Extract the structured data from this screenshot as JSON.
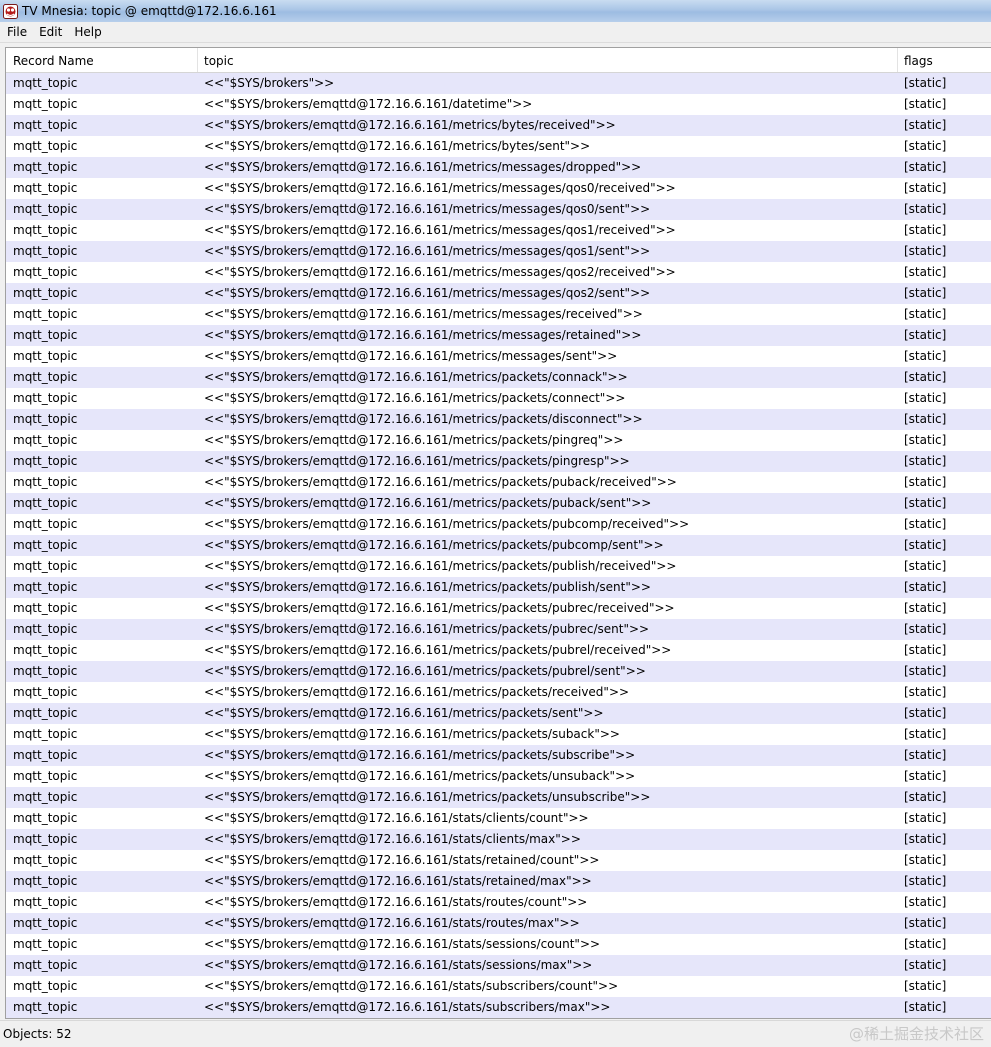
{
  "window": {
    "title": "TV Mnesia: topic @ emqttd@172.16.6.161",
    "icon": "tv-mnesia-app-icon"
  },
  "menu": [
    "File",
    "Edit",
    "Help"
  ],
  "table": {
    "columns": [
      "Record Name",
      "topic",
      "flags"
    ],
    "rows": [
      [
        "mqtt_topic",
        "<<\"$SYS/brokers\">>",
        "[static]"
      ],
      [
        "mqtt_topic",
        "<<\"$SYS/brokers/emqttd@172.16.6.161/datetime\">>",
        "[static]"
      ],
      [
        "mqtt_topic",
        "<<\"$SYS/brokers/emqttd@172.16.6.161/metrics/bytes/received\">>",
        "[static]"
      ],
      [
        "mqtt_topic",
        "<<\"$SYS/brokers/emqttd@172.16.6.161/metrics/bytes/sent\">>",
        "[static]"
      ],
      [
        "mqtt_topic",
        "<<\"$SYS/brokers/emqttd@172.16.6.161/metrics/messages/dropped\">>",
        "[static]"
      ],
      [
        "mqtt_topic",
        "<<\"$SYS/brokers/emqttd@172.16.6.161/metrics/messages/qos0/received\">>",
        "[static]"
      ],
      [
        "mqtt_topic",
        "<<\"$SYS/brokers/emqttd@172.16.6.161/metrics/messages/qos0/sent\">>",
        "[static]"
      ],
      [
        "mqtt_topic",
        "<<\"$SYS/brokers/emqttd@172.16.6.161/metrics/messages/qos1/received\">>",
        "[static]"
      ],
      [
        "mqtt_topic",
        "<<\"$SYS/brokers/emqttd@172.16.6.161/metrics/messages/qos1/sent\">>",
        "[static]"
      ],
      [
        "mqtt_topic",
        "<<\"$SYS/brokers/emqttd@172.16.6.161/metrics/messages/qos2/received\">>",
        "[static]"
      ],
      [
        "mqtt_topic",
        "<<\"$SYS/brokers/emqttd@172.16.6.161/metrics/messages/qos2/sent\">>",
        "[static]"
      ],
      [
        "mqtt_topic",
        "<<\"$SYS/brokers/emqttd@172.16.6.161/metrics/messages/received\">>",
        "[static]"
      ],
      [
        "mqtt_topic",
        "<<\"$SYS/brokers/emqttd@172.16.6.161/metrics/messages/retained\">>",
        "[static]"
      ],
      [
        "mqtt_topic",
        "<<\"$SYS/brokers/emqttd@172.16.6.161/metrics/messages/sent\">>",
        "[static]"
      ],
      [
        "mqtt_topic",
        "<<\"$SYS/brokers/emqttd@172.16.6.161/metrics/packets/connack\">>",
        "[static]"
      ],
      [
        "mqtt_topic",
        "<<\"$SYS/brokers/emqttd@172.16.6.161/metrics/packets/connect\">>",
        "[static]"
      ],
      [
        "mqtt_topic",
        "<<\"$SYS/brokers/emqttd@172.16.6.161/metrics/packets/disconnect\">>",
        "[static]"
      ],
      [
        "mqtt_topic",
        "<<\"$SYS/brokers/emqttd@172.16.6.161/metrics/packets/pingreq\">>",
        "[static]"
      ],
      [
        "mqtt_topic",
        "<<\"$SYS/brokers/emqttd@172.16.6.161/metrics/packets/pingresp\">>",
        "[static]"
      ],
      [
        "mqtt_topic",
        "<<\"$SYS/brokers/emqttd@172.16.6.161/metrics/packets/puback/received\">>",
        "[static]"
      ],
      [
        "mqtt_topic",
        "<<\"$SYS/brokers/emqttd@172.16.6.161/metrics/packets/puback/sent\">>",
        "[static]"
      ],
      [
        "mqtt_topic",
        "<<\"$SYS/brokers/emqttd@172.16.6.161/metrics/packets/pubcomp/received\">>",
        "[static]"
      ],
      [
        "mqtt_topic",
        "<<\"$SYS/brokers/emqttd@172.16.6.161/metrics/packets/pubcomp/sent\">>",
        "[static]"
      ],
      [
        "mqtt_topic",
        "<<\"$SYS/brokers/emqttd@172.16.6.161/metrics/packets/publish/received\">>",
        "[static]"
      ],
      [
        "mqtt_topic",
        "<<\"$SYS/brokers/emqttd@172.16.6.161/metrics/packets/publish/sent\">>",
        "[static]"
      ],
      [
        "mqtt_topic",
        "<<\"$SYS/brokers/emqttd@172.16.6.161/metrics/packets/pubrec/received\">>",
        "[static]"
      ],
      [
        "mqtt_topic",
        "<<\"$SYS/brokers/emqttd@172.16.6.161/metrics/packets/pubrec/sent\">>",
        "[static]"
      ],
      [
        "mqtt_topic",
        "<<\"$SYS/brokers/emqttd@172.16.6.161/metrics/packets/pubrel/received\">>",
        "[static]"
      ],
      [
        "mqtt_topic",
        "<<\"$SYS/brokers/emqttd@172.16.6.161/metrics/packets/pubrel/sent\">>",
        "[static]"
      ],
      [
        "mqtt_topic",
        "<<\"$SYS/brokers/emqttd@172.16.6.161/metrics/packets/received\">>",
        "[static]"
      ],
      [
        "mqtt_topic",
        "<<\"$SYS/brokers/emqttd@172.16.6.161/metrics/packets/sent\">>",
        "[static]"
      ],
      [
        "mqtt_topic",
        "<<\"$SYS/brokers/emqttd@172.16.6.161/metrics/packets/suback\">>",
        "[static]"
      ],
      [
        "mqtt_topic",
        "<<\"$SYS/brokers/emqttd@172.16.6.161/metrics/packets/subscribe\">>",
        "[static]"
      ],
      [
        "mqtt_topic",
        "<<\"$SYS/brokers/emqttd@172.16.6.161/metrics/packets/unsuback\">>",
        "[static]"
      ],
      [
        "mqtt_topic",
        "<<\"$SYS/brokers/emqttd@172.16.6.161/metrics/packets/unsubscribe\">>",
        "[static]"
      ],
      [
        "mqtt_topic",
        "<<\"$SYS/brokers/emqttd@172.16.6.161/stats/clients/count\">>",
        "[static]"
      ],
      [
        "mqtt_topic",
        "<<\"$SYS/brokers/emqttd@172.16.6.161/stats/clients/max\">>",
        "[static]"
      ],
      [
        "mqtt_topic",
        "<<\"$SYS/brokers/emqttd@172.16.6.161/stats/retained/count\">>",
        "[static]"
      ],
      [
        "mqtt_topic",
        "<<\"$SYS/brokers/emqttd@172.16.6.161/stats/retained/max\">>",
        "[static]"
      ],
      [
        "mqtt_topic",
        "<<\"$SYS/brokers/emqttd@172.16.6.161/stats/routes/count\">>",
        "[static]"
      ],
      [
        "mqtt_topic",
        "<<\"$SYS/brokers/emqttd@172.16.6.161/stats/routes/max\">>",
        "[static]"
      ],
      [
        "mqtt_topic",
        "<<\"$SYS/brokers/emqttd@172.16.6.161/stats/sessions/count\">>",
        "[static]"
      ],
      [
        "mqtt_topic",
        "<<\"$SYS/brokers/emqttd@172.16.6.161/stats/sessions/max\">>",
        "[static]"
      ],
      [
        "mqtt_topic",
        "<<\"$SYS/brokers/emqttd@172.16.6.161/stats/subscribers/count\">>",
        "[static]"
      ],
      [
        "mqtt_topic",
        "<<\"$SYS/brokers/emqttd@172.16.6.161/stats/subscribers/max\">>",
        "[static]"
      ]
    ]
  },
  "status": {
    "objects": "Objects: 52"
  },
  "watermark": "@稀土掘金技术社区",
  "colors": {
    "row_alt": "#e6e6fa",
    "row_base": "#ffffff",
    "title_bar": "#a9c5e6"
  }
}
